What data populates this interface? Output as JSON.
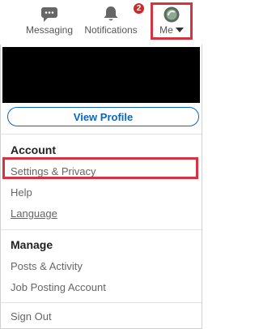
{
  "nav": {
    "messaging_label": "Messaging",
    "notifications_label": "Notifications",
    "notifications_count": "2",
    "me_label": "Me"
  },
  "menu": {
    "view_profile": "View Profile",
    "account_title": "Account",
    "settings_privacy": "Settings & Privacy",
    "help": "Help",
    "language": "Language",
    "manage_title": "Manage",
    "posts_activity": "Posts & Activity",
    "job_posting_account": "Job Posting Account",
    "sign_out": "Sign Out"
  },
  "colors": {
    "highlight": "#d3343f",
    "link_blue": "#0a66c2",
    "badge_red": "#cc2a2a"
  }
}
